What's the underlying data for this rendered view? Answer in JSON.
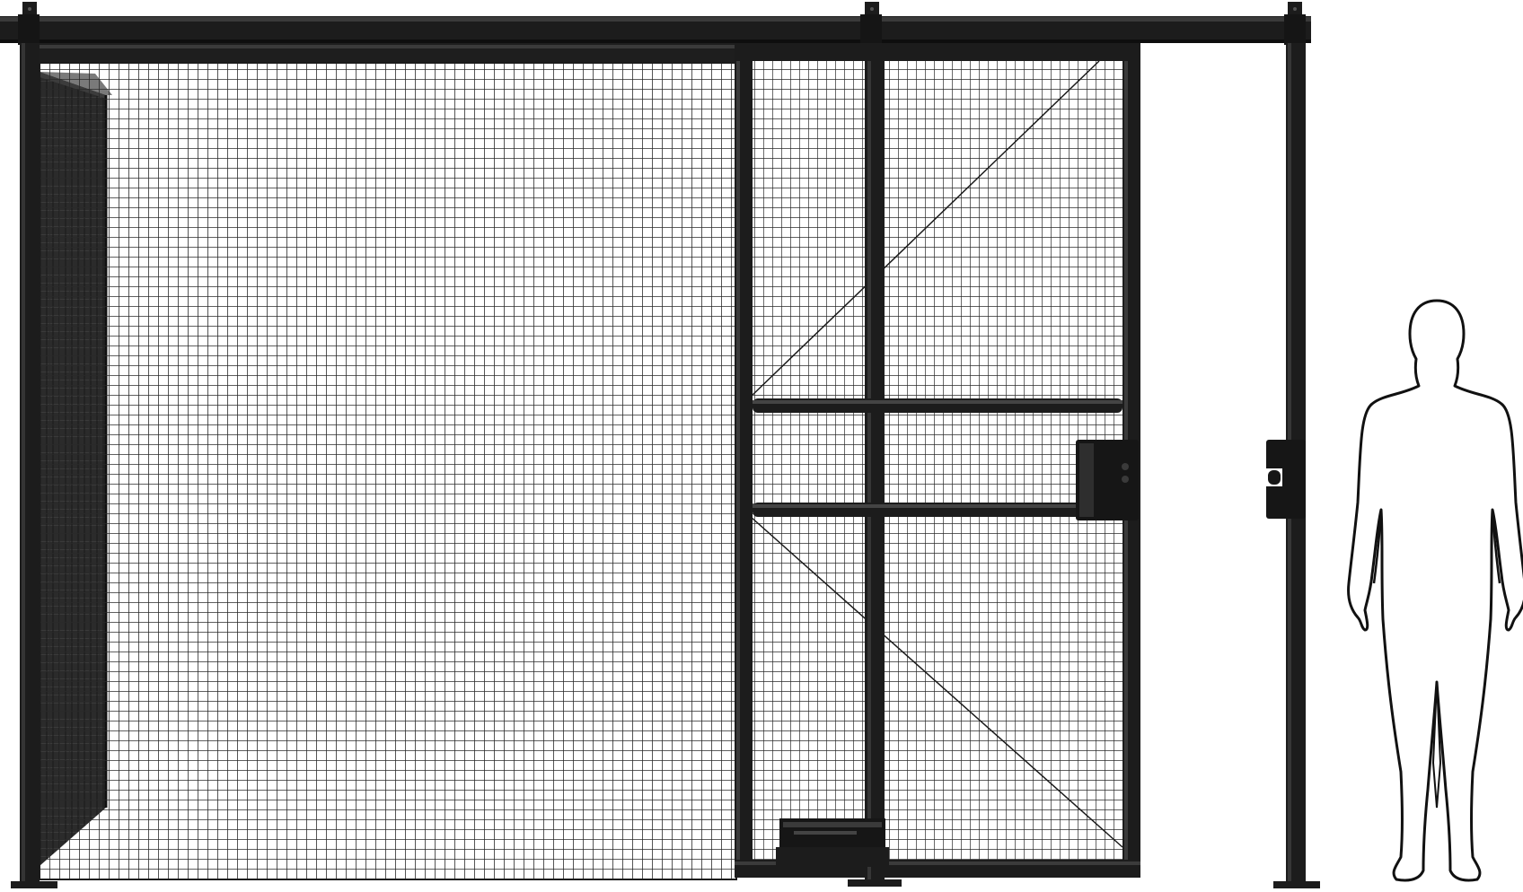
{
  "image": {
    "subject": "sliding-mesh-gate-with-human-scale-figure",
    "background_color": "#ffffff",
    "frame_color": "#1c1c1c",
    "mesh_color": "#222222",
    "figure_outline_color": "#111111",
    "figure_fill_color": "#ffffff",
    "icon_names": [
      "sliding-gate-icon",
      "human-silhouette-icon",
      "latch-icon",
      "track-icon"
    ]
  }
}
